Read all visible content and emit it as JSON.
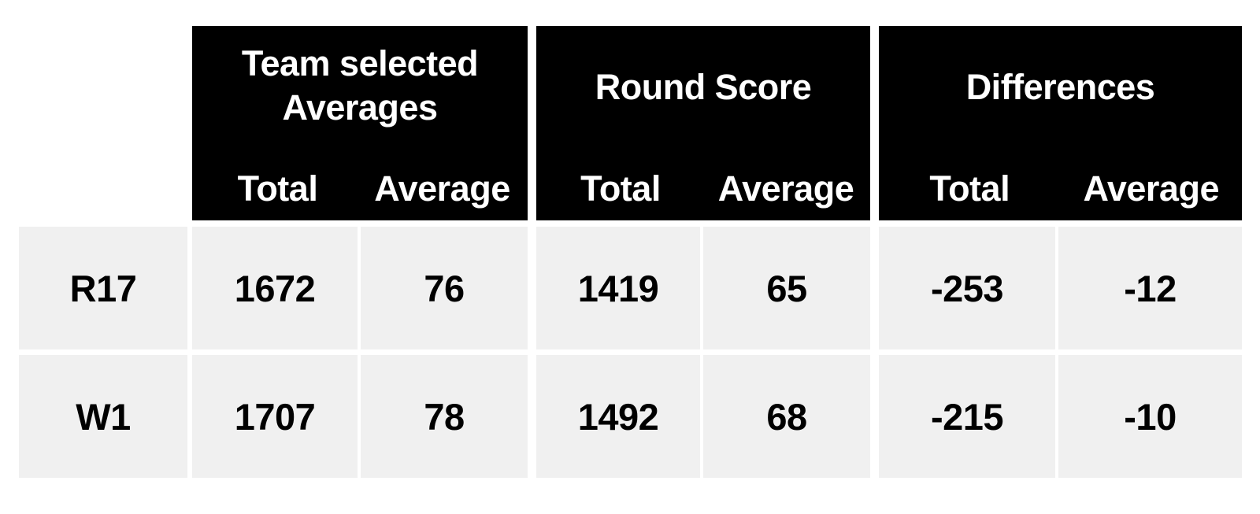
{
  "table": {
    "corner_label": "",
    "groups": [
      {
        "title": "Team selected Averages",
        "sub": [
          "Total",
          "Average"
        ]
      },
      {
        "title": "Round Score",
        "sub": [
          "Total",
          "Average"
        ]
      },
      {
        "title": "Differences",
        "sub": [
          "Total",
          "Average"
        ]
      }
    ],
    "rows": [
      {
        "label": "R17",
        "team_selected_total": "1672",
        "team_selected_average": "76",
        "round_score_total": "1419",
        "round_score_average": "65",
        "differences_total": "-253",
        "differences_average": "-12"
      },
      {
        "label": "W1",
        "team_selected_total": "1707",
        "team_selected_average": "78",
        "round_score_total": "1492",
        "round_score_average": "68",
        "differences_total": "-215",
        "differences_average": "-10"
      }
    ],
    "colors": {
      "header_background": "#000000",
      "header_text": "#ffffff",
      "row_background": "#f0f0f0",
      "row_text": "#000000",
      "page_background": "#ffffff"
    }
  },
  "chart_data": {
    "type": "table",
    "title": "",
    "columns": [
      "",
      "Team selected Averages - Total",
      "Team selected Averages - Average",
      "Round Score - Total",
      "Round Score - Average",
      "Differences - Total",
      "Differences - Average"
    ],
    "rows": [
      [
        "R17",
        1672,
        76,
        1419,
        65,
        -253,
        -12
      ],
      [
        "W1",
        1707,
        78,
        1492,
        68,
        -215,
        -10
      ]
    ]
  }
}
